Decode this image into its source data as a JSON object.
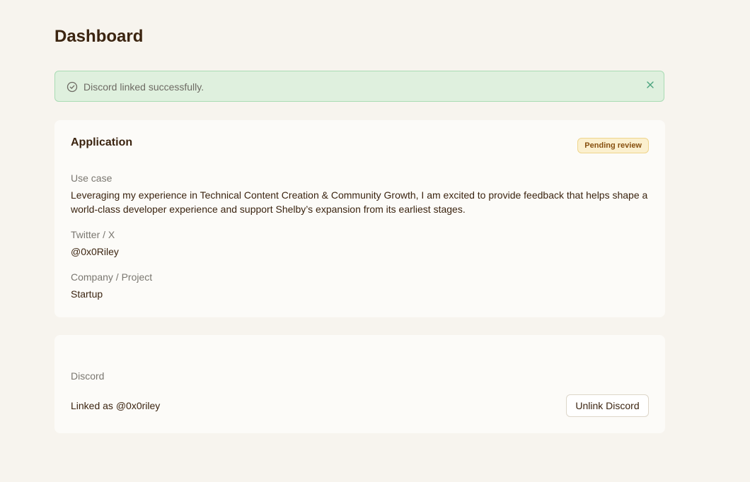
{
  "page": {
    "title": "Dashboard"
  },
  "alert": {
    "icon": "check-circle-icon",
    "message": "Discord linked successfully.",
    "close_icon": "close-icon",
    "colors": {
      "background": "#dff0de",
      "border": "#a9dcb4",
      "icon": "#6d6a63",
      "close": "#4aa37e"
    }
  },
  "application": {
    "title": "Application",
    "status": "Pending review",
    "status_colors": {
      "background": "#fbf0cf",
      "text": "#87500f"
    },
    "fields": [
      {
        "label": "Use case",
        "value": "Leveraging my experience in Technical Content Creation & Community Growth, I am excited to provide feedback that helps shape a world-class developer experience and support Shelby’s expansion from its earliest stages."
      },
      {
        "label": "Twitter / X",
        "value": "@0x0Riley"
      },
      {
        "label": "Company / Project",
        "value": "Startup"
      }
    ]
  },
  "discord": {
    "label": "Discord",
    "status_text": "Linked as @0x0riley",
    "button_label": "Unlink Discord"
  }
}
